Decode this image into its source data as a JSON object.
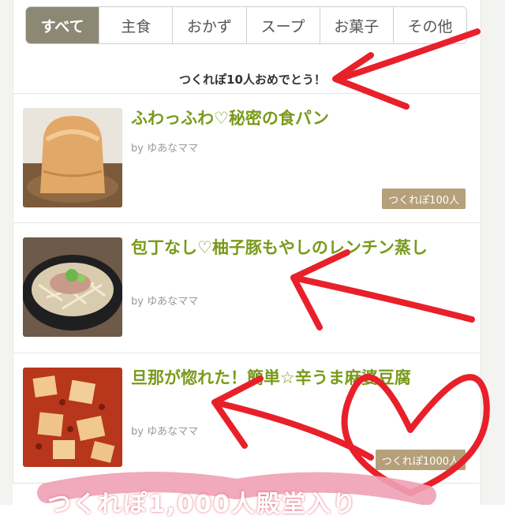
{
  "tabs": [
    {
      "label": "すべて",
      "active": true
    },
    {
      "label": "主食",
      "active": false
    },
    {
      "label": "おかず",
      "active": false
    },
    {
      "label": "スープ",
      "active": false
    },
    {
      "label": "お菓子",
      "active": false
    },
    {
      "label": "その他",
      "active": false
    }
  ],
  "notice": "つくれぽ10人おめでとう！",
  "recipes": [
    {
      "title": "ふわっふわ♡秘密の食パン",
      "author": "by ゆあなママ",
      "badge": "つくれぽ100人"
    },
    {
      "title": "包丁なし♡柚子豚もやしのレンチン蒸し",
      "author": "by ゆあなママ",
      "badge": ""
    },
    {
      "title": "旦那が惚れた！簡単☆辛うま麻婆豆腐",
      "author": "by ゆあなママ",
      "badge": "つくれぽ1000人"
    }
  ],
  "banner_text": "つくれぽ1,000人殿堂入り",
  "colors": {
    "tab_active_bg": "#8c8873",
    "recipe_title": "#7a9a1a",
    "badge_bg": "#b5a07a",
    "annotation_red": "#e8202a",
    "banner_pink": "#f0a0b5"
  },
  "thumb_icons": [
    "bread-photo",
    "bean-sprout-pork-photo",
    "mapo-tofu-photo"
  ]
}
